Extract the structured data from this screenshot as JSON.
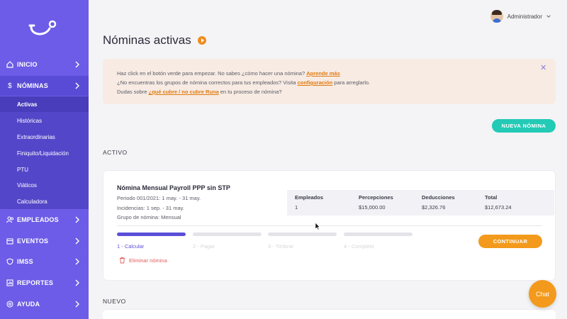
{
  "sidebar": {
    "items": [
      {
        "label": "INICIO"
      },
      {
        "label": "NÓMINAS"
      },
      {
        "label": "EMPLEADOS"
      },
      {
        "label": "EVENTOS"
      },
      {
        "label": "IMSS"
      },
      {
        "label": "REPORTES"
      },
      {
        "label": "AYUDA"
      }
    ],
    "nominas_prefix": "$",
    "submenu": [
      {
        "label": "Activas"
      },
      {
        "label": "Históricas"
      },
      {
        "label": "Extraordinarias"
      },
      {
        "label": "Finiquito/Liquidación"
      },
      {
        "label": "PTU"
      },
      {
        "label": "Viáticos"
      },
      {
        "label": "Calculadora"
      }
    ]
  },
  "user": {
    "name": "Administrador"
  },
  "page": {
    "title": "Nóminas activas"
  },
  "banner": {
    "line1_text": "Haz click en el botón verde para empezar. No sabes ¿cómo hacer una nómina? ",
    "line1_link": "Aprende más",
    "line2_text": "¿No encuentras los grupos de nómina correctos para tus empleados? Visita ",
    "line2_link": "configuración",
    "line2_suffix": " para arreglarlo.",
    "line3_text": "Dudas sobre ",
    "line3_link": "¿qué cubre / no cubre Runa",
    "line3_suffix": " en tu proceso de nómina?",
    "close_glyph": "✕"
  },
  "new_button": "NUEVA NÓMINA",
  "sections": {
    "active": "ACTIVO",
    "new": "NUEVO"
  },
  "payroll_card": {
    "title": "Nómina Mensual Payroll PPP sin STP",
    "period": "Periodo 001/2021: 1 may. - 31 may.",
    "incidents": "Incidencias: 1 sep. - 31 may.",
    "group": "Grupo de nómina: Mensual",
    "stats": [
      {
        "header": "Empleados",
        "value": "1"
      },
      {
        "header": "Percepciones",
        "value": "$15,000.00"
      },
      {
        "header": "Deducciones",
        "value": "$2,326.76"
      },
      {
        "header": "Total",
        "value": "$12,673.24"
      }
    ],
    "steps": [
      {
        "label": "1 - Calcular",
        "done": true
      },
      {
        "label": "2 - Pagar",
        "done": false
      },
      {
        "label": "3 - Timbrar",
        "done": false
      },
      {
        "label": "4 - Completo",
        "done": false
      }
    ],
    "continue_button": "CONTINUAR",
    "delete_label": "Eliminar nómina"
  },
  "chat_button": "Chat",
  "colors": {
    "sidebar": "#6c5ce7",
    "accent_orange": "#f39a1c",
    "accent_teal": "#23cab6",
    "step_done": "#5b4fd8",
    "danger": "#e25b5b"
  }
}
